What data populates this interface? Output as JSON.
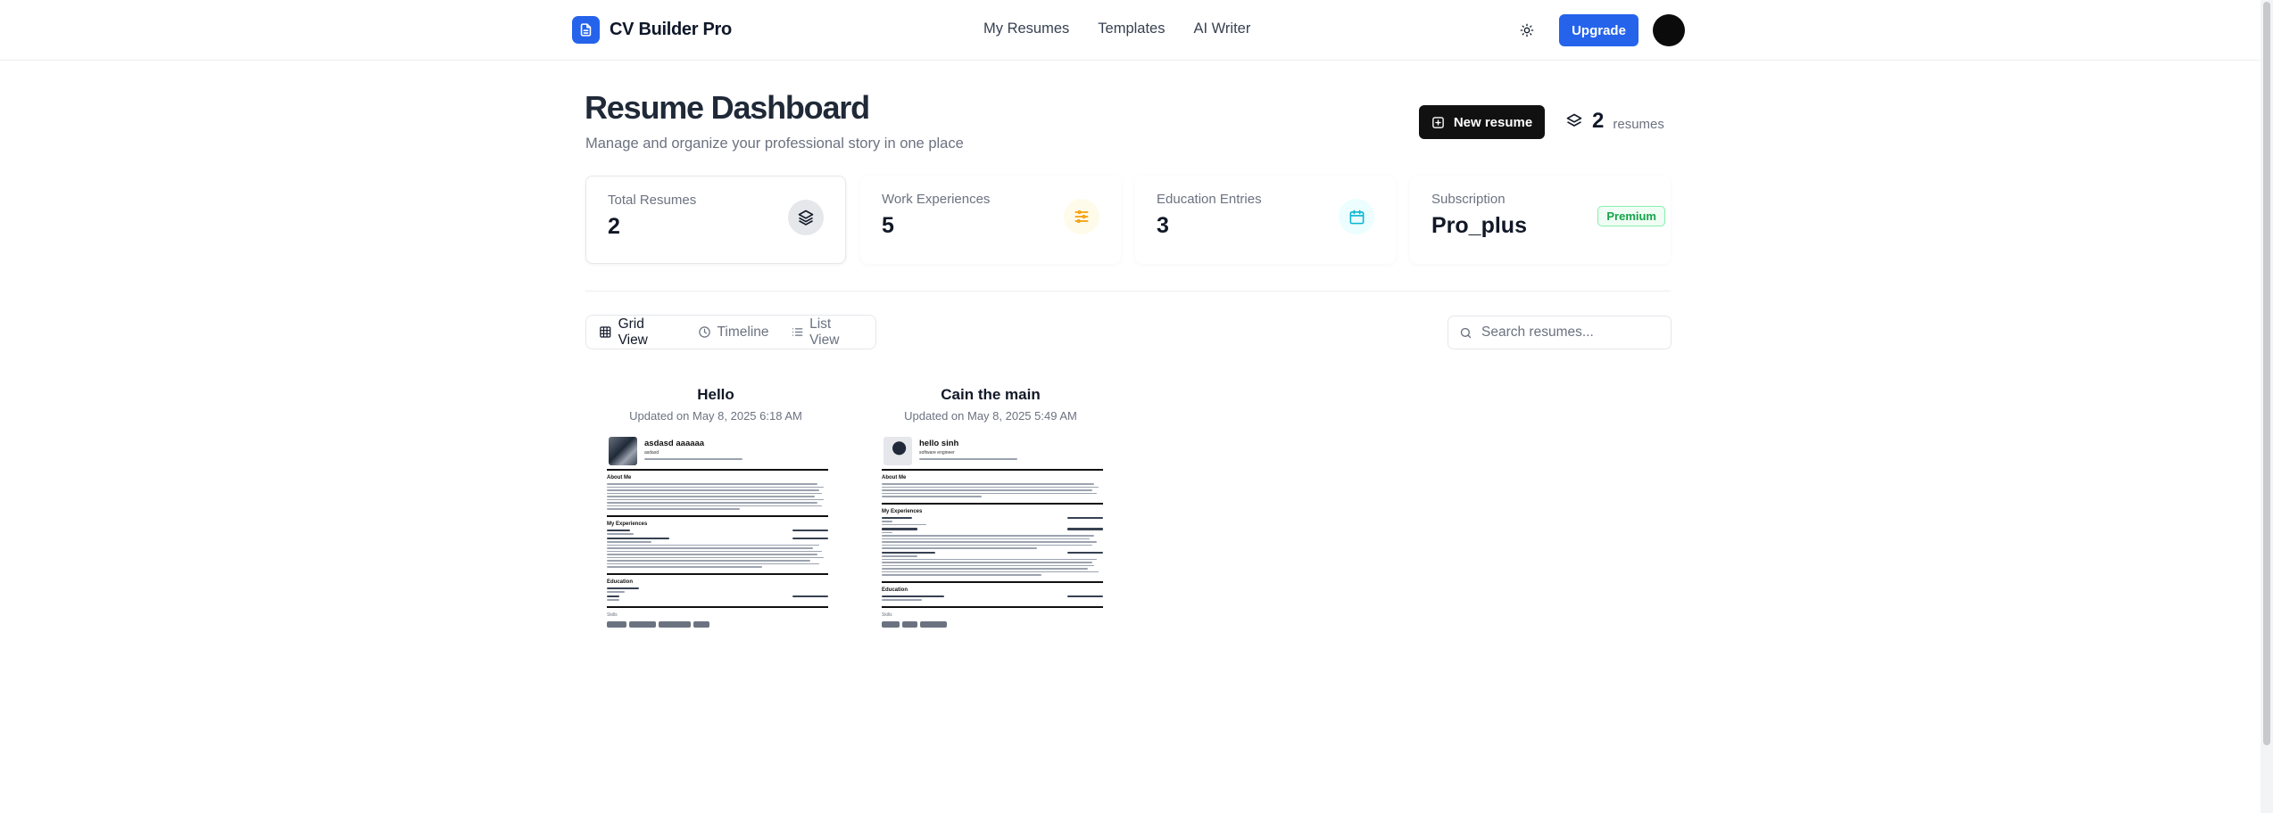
{
  "app": {
    "name": "CV Builder Pro"
  },
  "nav": {
    "items": [
      "My Resumes",
      "Templates",
      "AI Writer"
    ],
    "upgrade_label": "Upgrade"
  },
  "dashboard": {
    "title": "Resume Dashboard",
    "subtitle": "Manage and organize your professional story in one place",
    "new_resume_label": "New resume",
    "resume_count": "2",
    "resume_count_unit": "resumes"
  },
  "stats": [
    {
      "label": "Total Resumes",
      "value": "2",
      "icon": "layers-icon"
    },
    {
      "label": "Work Experiences",
      "value": "5",
      "icon": "sliders-icon"
    },
    {
      "label": "Education Entries",
      "value": "3",
      "icon": "calendar-icon"
    },
    {
      "label": "Subscription",
      "value": "Pro_plus",
      "badge": "Premium"
    }
  ],
  "views": {
    "tabs": [
      "Grid View",
      "Timeline",
      "List View"
    ],
    "active": "Grid View"
  },
  "search": {
    "placeholder": "Search resumes...",
    "value": ""
  },
  "resumes": [
    {
      "title": "Hello",
      "updated": "Updated on May 8, 2025 6:18 AM",
      "preview": {
        "name": "asdasd aaaaaa",
        "role": "asdasd",
        "sections": [
          "About Me",
          "My Experiences",
          "Education",
          "Skills"
        ]
      }
    },
    {
      "title": "Cain the main",
      "updated": "Updated on May 8, 2025 5:49 AM",
      "preview": {
        "name": "hello sinh",
        "role": "software engineer",
        "sections": [
          "About Me",
          "My Experiences",
          "Education",
          "Skills"
        ]
      }
    }
  ],
  "colors": {
    "primary": "#2563eb",
    "dark": "#111111",
    "premium": "#16a34a",
    "amber": "#f59e0b",
    "cyan": "#06b6d4"
  }
}
